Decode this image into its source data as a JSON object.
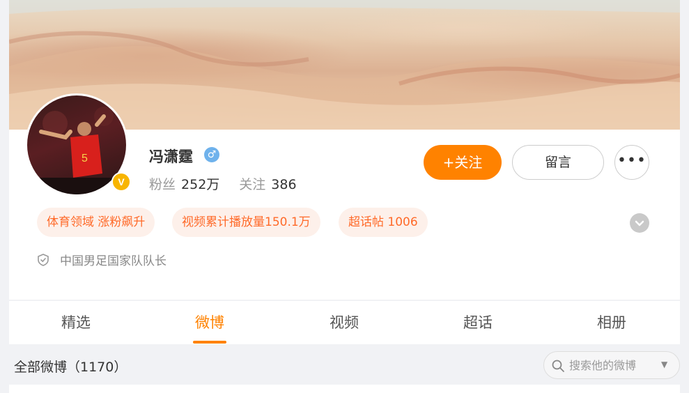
{
  "profile": {
    "name": "冯潇霆",
    "gender_symbol": "♂",
    "verify_symbol": "V",
    "followers_label": "粉丝",
    "followers_value": "252万",
    "following_label": "关注",
    "following_value": "386",
    "description": "中国男足国家队队长"
  },
  "actions": {
    "follow_label": "+关注",
    "message_label": "留言",
    "more_label": "•••"
  },
  "tags": [
    "体育领域 涨粉飙升",
    "视频累计播放量150.1万",
    "超话帖 1006"
  ],
  "tabs": [
    {
      "label": "精选",
      "active": false
    },
    {
      "label": "微博",
      "active": true
    },
    {
      "label": "视频",
      "active": false
    },
    {
      "label": "超话",
      "active": false
    },
    {
      "label": "相册",
      "active": false
    }
  ],
  "feed": {
    "title": "全部微博（1170）",
    "search_placeholder": "搜索他的微博",
    "caret": "▼"
  },
  "colors": {
    "accent": "#ff8200",
    "tag_text": "#ff6a29",
    "tag_bg": "#fdf0ea",
    "verify": "#f8b500",
    "gender": "#6fb2ec"
  },
  "icons": {
    "expand": "chevron-down-icon",
    "description": "shield-icon",
    "search": "search-icon"
  }
}
